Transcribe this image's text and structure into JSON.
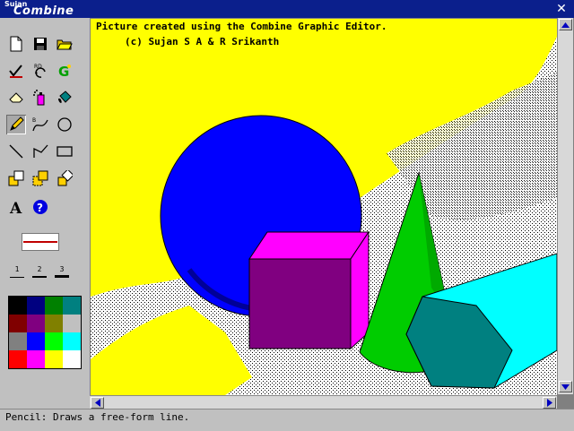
{
  "app": {
    "logo_small": "Sujan",
    "logo_main": "Combine",
    "close_icon": "close-x-icon"
  },
  "toolbar": {
    "tools": [
      {
        "name": "new",
        "icon": "new-file-icon"
      },
      {
        "name": "save",
        "icon": "save-disk-icon"
      },
      {
        "name": "open",
        "icon": "open-folder-icon"
      },
      {
        "name": "check",
        "icon": "checkmark-icon"
      },
      {
        "name": "undo-redo",
        "icon": "undo-redo-icon",
        "label": "RD"
      },
      {
        "name": "graphic",
        "icon": "graphic-g-icon",
        "label": "G"
      },
      {
        "name": "eraser",
        "icon": "eraser-icon"
      },
      {
        "name": "spray",
        "icon": "spray-can-icon"
      },
      {
        "name": "fill",
        "icon": "paint-bucket-icon"
      },
      {
        "name": "pencil",
        "icon": "pencil-icon",
        "active": true
      },
      {
        "name": "curve",
        "icon": "curve-icon",
        "label": "B"
      },
      {
        "name": "circle",
        "icon": "circle-icon"
      },
      {
        "name": "line",
        "icon": "line-icon"
      },
      {
        "name": "polyline",
        "icon": "polyline-icon"
      },
      {
        "name": "rectangle",
        "icon": "rectangle-icon"
      },
      {
        "name": "copy",
        "icon": "copy-block-icon"
      },
      {
        "name": "move",
        "icon": "move-block-icon"
      },
      {
        "name": "rotate",
        "icon": "rotate-block-icon"
      },
      {
        "name": "text",
        "icon": "text-icon",
        "label": "A"
      },
      {
        "name": "help",
        "icon": "help-icon",
        "label": "?"
      }
    ],
    "line_color": "#c00000",
    "widths": [
      "1",
      "2",
      "3"
    ],
    "palette": [
      "#000000",
      "#000080",
      "#008000",
      "#008080",
      "#800000",
      "#800080",
      "#808000",
      "#c0c0c0",
      "#808080",
      "#0000ff",
      "#00ff00",
      "#00ffff",
      "#ff0000",
      "#ff00ff",
      "#ffff00",
      "#ffffff"
    ]
  },
  "canvas": {
    "line1": "Picture created using the Combine Graphic Editor.",
    "line2": "(c) Sujan S A & R Srikanth",
    "background": "#ffff00",
    "sphere_color": "#0000ff",
    "cube_front": "#800080",
    "cube_top": "#ff00ff",
    "cone_color": "#00cc00",
    "prism_color": "#00ffff",
    "prism_front": "#008080"
  },
  "status": {
    "text": "Pencil: Draws a free-form line."
  }
}
